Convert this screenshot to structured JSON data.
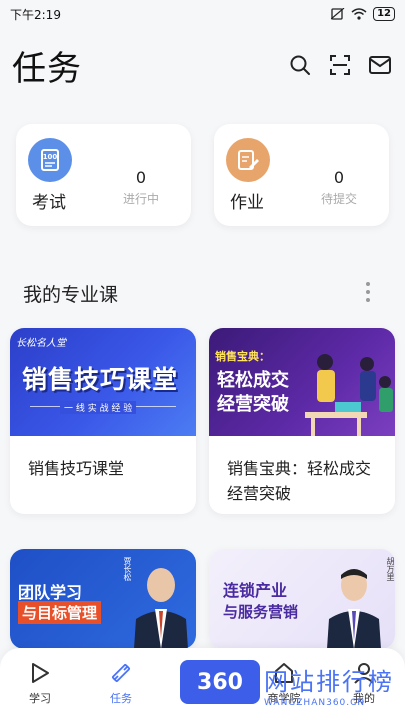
{
  "status_bar": {
    "time": "下午2:19",
    "battery": "12"
  },
  "header": {
    "title": "任务"
  },
  "stats": [
    {
      "name": "考试",
      "count": "0",
      "status": "进行中",
      "icon_color": "#5b8fe8",
      "icon": "exam-icon"
    },
    {
      "name": "作业",
      "count": "0",
      "status": "待提交",
      "icon_color": "#e8a56b",
      "icon": "homework-icon"
    }
  ],
  "section": {
    "title": "我的专业课"
  },
  "courses": [
    {
      "name": "销售技巧课堂",
      "thumb_top": "长松名人堂",
      "thumb_main": "销售技巧课堂",
      "thumb_sub": "一 线 实 战 经 验"
    },
    {
      "name": "销售宝典：轻松成交经营突破",
      "thumb_top": "销售宝典：",
      "thumb_main1": "轻松成交",
      "thumb_main2": "经营突破"
    },
    {
      "name": "",
      "thumb_main1": "团队学习",
      "thumb_main2": "与目标管理",
      "thumb_person": "贾长松"
    },
    {
      "name": "",
      "thumb_main1": "连锁产业",
      "thumb_main2": "与服务营销",
      "thumb_person": "胡万里"
    }
  ],
  "tabs": [
    {
      "label": "学习",
      "icon": "play-icon"
    },
    {
      "label": "任务",
      "icon": "pencil-ruler-icon",
      "active": true
    },
    {
      "label": "商学院",
      "icon": "building-icon"
    },
    {
      "label": "我的",
      "icon": "person-icon"
    }
  ],
  "watermark": {
    "badge": "360",
    "text": "网站排行榜",
    "url": "WANGZHAN360.CN"
  }
}
